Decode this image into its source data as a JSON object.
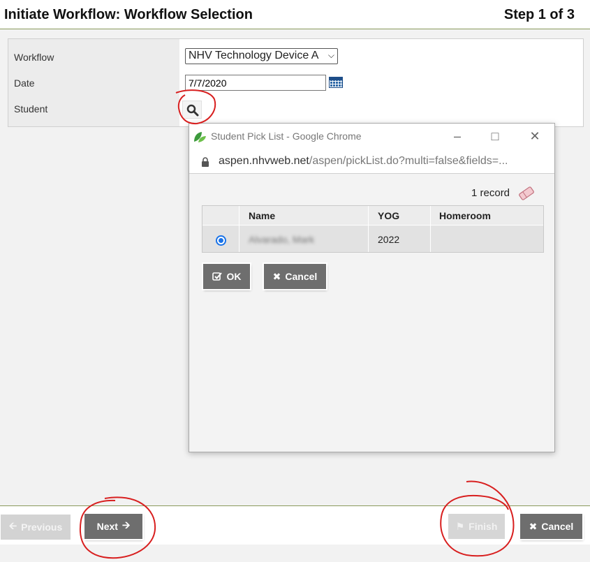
{
  "header": {
    "title": "Initiate Workflow: Workflow Selection",
    "step": "Step 1 of 3"
  },
  "form": {
    "workflow_label": "Workflow",
    "workflow_value": "NHV Technology Device A",
    "date_label": "Date",
    "date_value": "7/7/2020",
    "student_label": "Student"
  },
  "popup": {
    "window_title": "Student Pick List - Google Chrome",
    "url_host": "aspen.nhvweb.net",
    "url_path": "/aspen/pickList.do?multi=false&fields=...",
    "record_count": "1 record",
    "columns": [
      "Name",
      "YOG",
      "Homeroom"
    ],
    "rows": [
      {
        "name": "Alvarado, Mark",
        "yog": "2022",
        "homeroom": ""
      }
    ],
    "ok_label": "OK",
    "cancel_label": "Cancel"
  },
  "footer": {
    "previous_label": "Previous",
    "next_label": "Next",
    "finish_label": "Finish",
    "cancel_label": "Cancel"
  },
  "colors": {
    "accent_line": "#8a9a5b",
    "button_dark": "#6e6e6e",
    "annotation": "#d81f1f",
    "radio": "#1a73e8"
  }
}
